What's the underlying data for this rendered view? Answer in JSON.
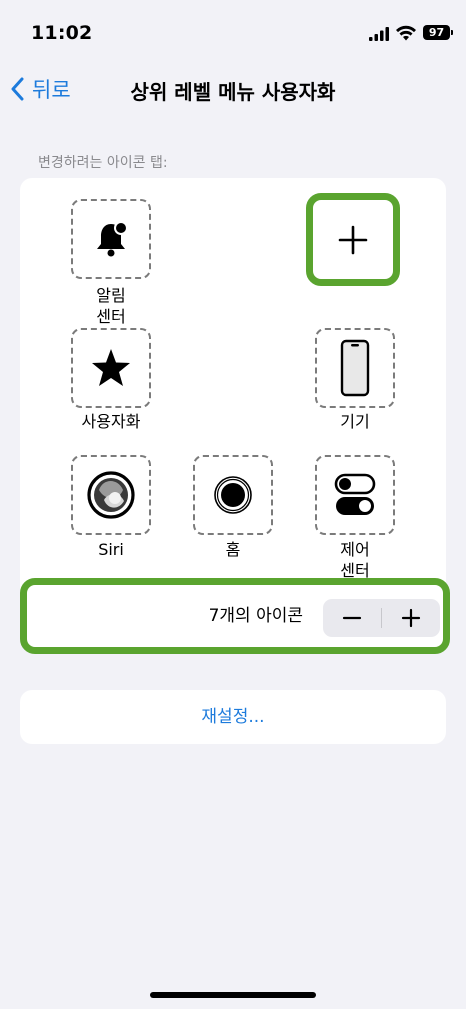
{
  "status_bar": {
    "time": "11:02",
    "battery": "97"
  },
  "nav": {
    "back_label": "뒤로",
    "title": "상위 레벨 메뉴 사용자화"
  },
  "section_header": "변경하려는 아이콘 탭:",
  "icons": {
    "notification_center": {
      "label_line1": "알림",
      "label_line2": "센터",
      "icon": "bell-badge-icon"
    },
    "add": {
      "icon": "plus-icon"
    },
    "customize": {
      "label": "사용자화",
      "icon": "star-icon"
    },
    "device": {
      "label": "기기",
      "icon": "iphone-icon"
    },
    "siri": {
      "label": "Siri",
      "icon": "siri-icon"
    },
    "home": {
      "label": "홈",
      "icon": "home-button-icon"
    },
    "control_center": {
      "label_line1": "제어",
      "label_line2": "센터",
      "icon": "toggles-icon"
    }
  },
  "count": {
    "label": "7개의 아이콘",
    "decrement_icon": "minus-icon",
    "increment_icon": "plus-icon"
  },
  "reset": {
    "label": "재설정..."
  },
  "colors": {
    "accent": "#1d7bdc",
    "highlight": "#5aa42f",
    "background": "#f2f2f7"
  }
}
